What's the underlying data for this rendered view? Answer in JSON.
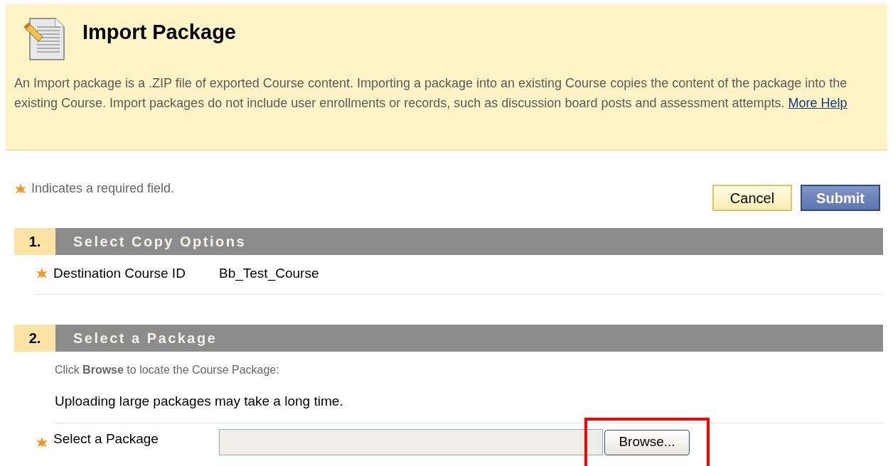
{
  "header": {
    "title": "Import Package",
    "description": "An Import package is a .ZIP file of exported Course content. Importing a package into an existing Course copies the content of the package into the existing Course. Import packages do not include user enrollments or records, such as discussion board posts and assessment attempts.",
    "help_link": "More Help"
  },
  "required_note": "Indicates a required field.",
  "buttons": [
    {
      "label": "Cancel",
      "kind": "secondary"
    },
    {
      "label": "Submit",
      "kind": "primary"
    }
  ],
  "sections": [
    {
      "number": "1.",
      "title": "Select Copy Options",
      "rows": [
        {
          "kind": "value",
          "label": "Destination Course ID",
          "required": true,
          "value": "Bb_Test_Course"
        }
      ]
    },
    {
      "number": "2.",
      "title": "Select a Package",
      "rows": [
        {
          "kind": "hint",
          "text": "Click **Browse** to locate the Course Package:"
        },
        {
          "kind": "note",
          "text": "Uploading large packages may take a long time."
        },
        {
          "kind": "file",
          "label": "Select a Package",
          "required": true,
          "button": "Browse...",
          "highlighted": true
        }
      ]
    }
  ]
}
